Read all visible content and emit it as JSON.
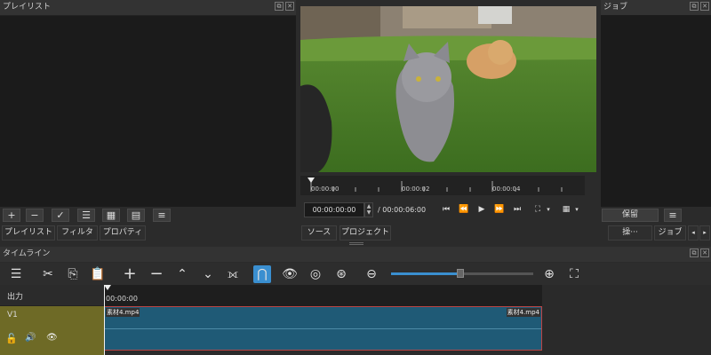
{
  "playlist": {
    "title": "プレイリスト",
    "tabs": [
      "プレイリスト",
      "フィルタ",
      "プロパティ"
    ],
    "toolbar": [
      "+",
      "−",
      "✓",
      "☰",
      "▦",
      "▤",
      "≡"
    ]
  },
  "player": {
    "ruler_ticks": [
      "00:00:00",
      "00:00:02",
      "00:00:04"
    ],
    "current_time": "00:00:00:00",
    "total_time": "/ 00:00:06:00",
    "tabs": [
      "ソース",
      "プロジェクト"
    ]
  },
  "jobs": {
    "title": "ジョブ",
    "hold_button": "保留",
    "menu_button": "≡",
    "ops_button": "操···",
    "tab": "ジョブ"
  },
  "timeline": {
    "title": "タイムライン",
    "output_label": "出力",
    "track_label": "V1",
    "ruler_start": "00:00:00",
    "clip_name_left": "素材4.mp4",
    "clip_name_right": "素材4.mp4"
  },
  "colors": {
    "track_head": "#6e6a26",
    "clip": "#1f5a76",
    "clip_border": "#bb4444",
    "accent": "#3a8fd0"
  }
}
